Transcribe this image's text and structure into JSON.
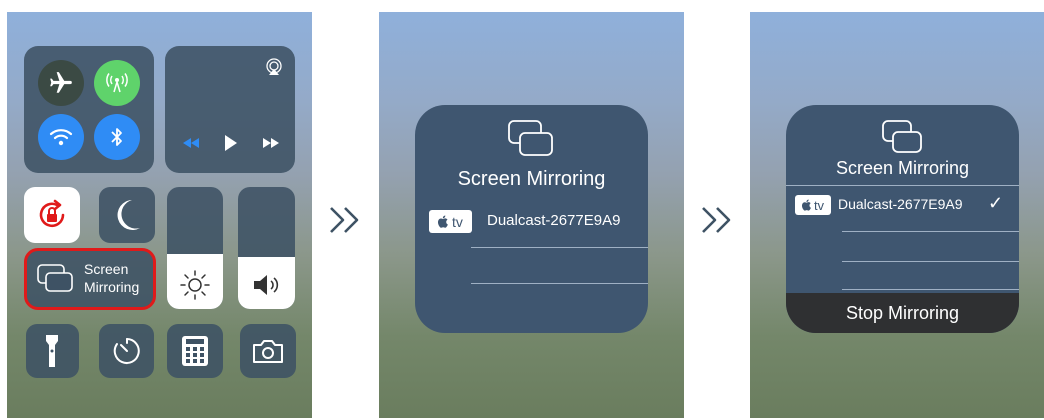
{
  "control_center": {
    "screen_mirroring_tile": {
      "line1": "Screen",
      "line2": "Mirroring"
    },
    "icons": [
      "airplane-icon",
      "cellular-icon",
      "wifi-icon",
      "bluetooth-icon",
      "airplay-icon",
      "rewind-icon",
      "play-icon",
      "fast-forward-icon",
      "rotation-lock-icon",
      "moon-icon",
      "brightness-icon",
      "volume-icon",
      "flashlight-icon",
      "timer-icon",
      "calculator-icon",
      "camera-icon"
    ],
    "colors": {
      "airplane": "#3b4a44",
      "cellular": "#5fd36b",
      "wifi": "#2f8cf5",
      "bluetooth": "#2f8cf5",
      "highlight_border": "#e01a1a",
      "rotation_lock": "#e01a1a"
    }
  },
  "mirroring_dialog": {
    "title": "Screen Mirroring",
    "device_label": "Dualcast-2677E9A9",
    "appletv_badge": "tv"
  },
  "mirroring_connected": {
    "title": "Screen Mirroring",
    "device_label": "Dualcast-2677E9A9",
    "appletv_badge": "tv",
    "checkmark": "✓",
    "stop_button": "Stop Mirroring"
  }
}
